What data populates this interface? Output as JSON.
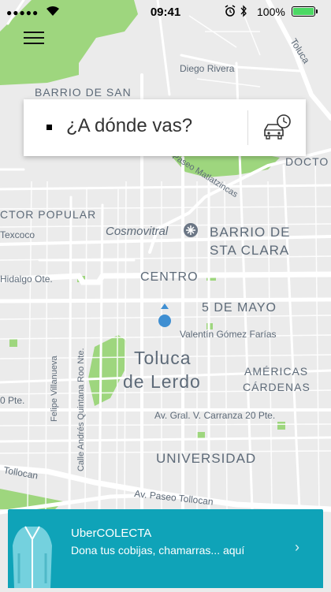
{
  "status_bar": {
    "carrier_dots": "●●●●●",
    "time": "09:41",
    "battery_percent": "100%",
    "battery_level": 1.0
  },
  "search": {
    "placeholder": "¿A dónde vas?"
  },
  "map_labels": {
    "toluca_road": "Toluca",
    "diego_rivera": "Diego Rivera",
    "barrio_de_san": "BARRIO DE SAN",
    "docto": "DOCTO",
    "paseo_matlatzincas": "Paseo Matlatzincas",
    "ctor_popular": "CTOR POPULAR",
    "texcoco": "Texcoco",
    "cosmovitral": "Cosmovitral",
    "barrio_sta_clara_1": "BARRIO DE",
    "barrio_sta_clara_2": "STA CLARA",
    "hidalgo": "Hidalgo Ote.",
    "centro": "CENTRO",
    "cinco_de_mayo": "5 DE MAYO",
    "valentin": "Valentín Gómez Farías",
    "toluca_city": "Toluca",
    "de_lerdo": "de Lerdo",
    "felipe_villanueva": "Felipe Villanueva",
    "calle_andres": "Calle Andrés Quintana Roo Nte.",
    "americas": "AMÉRICAS",
    "cardenas": "CÁRDENAS",
    "pte_20": "0 Pte.",
    "carranza": "Av. Gral. V. Carranza 20 Pte.",
    "universidad": "UNIVERSIDAD",
    "tollocan_left": "Tollocan",
    "paseo_tollocan": "Av. Paseo Tollocan"
  },
  "promo": {
    "title": "UberCOLECTA",
    "subtitle": "Dona tus cobijas, chamarras... aquí",
    "chevron": "›"
  },
  "icons": {
    "menu": "hamburger-menu-icon",
    "schedule": "schedule-ride-icon",
    "location": "current-location-icon",
    "landmark": "cosmovitral-landmark-icon"
  },
  "colors": {
    "map_bg": "#ebebeb",
    "road": "#ffffff",
    "park": "#9ed67e",
    "label": "#5d6a78",
    "location_dot": "#3f8fd2",
    "promo_bg": "#0fa3b8",
    "battery": "#4cd964"
  }
}
